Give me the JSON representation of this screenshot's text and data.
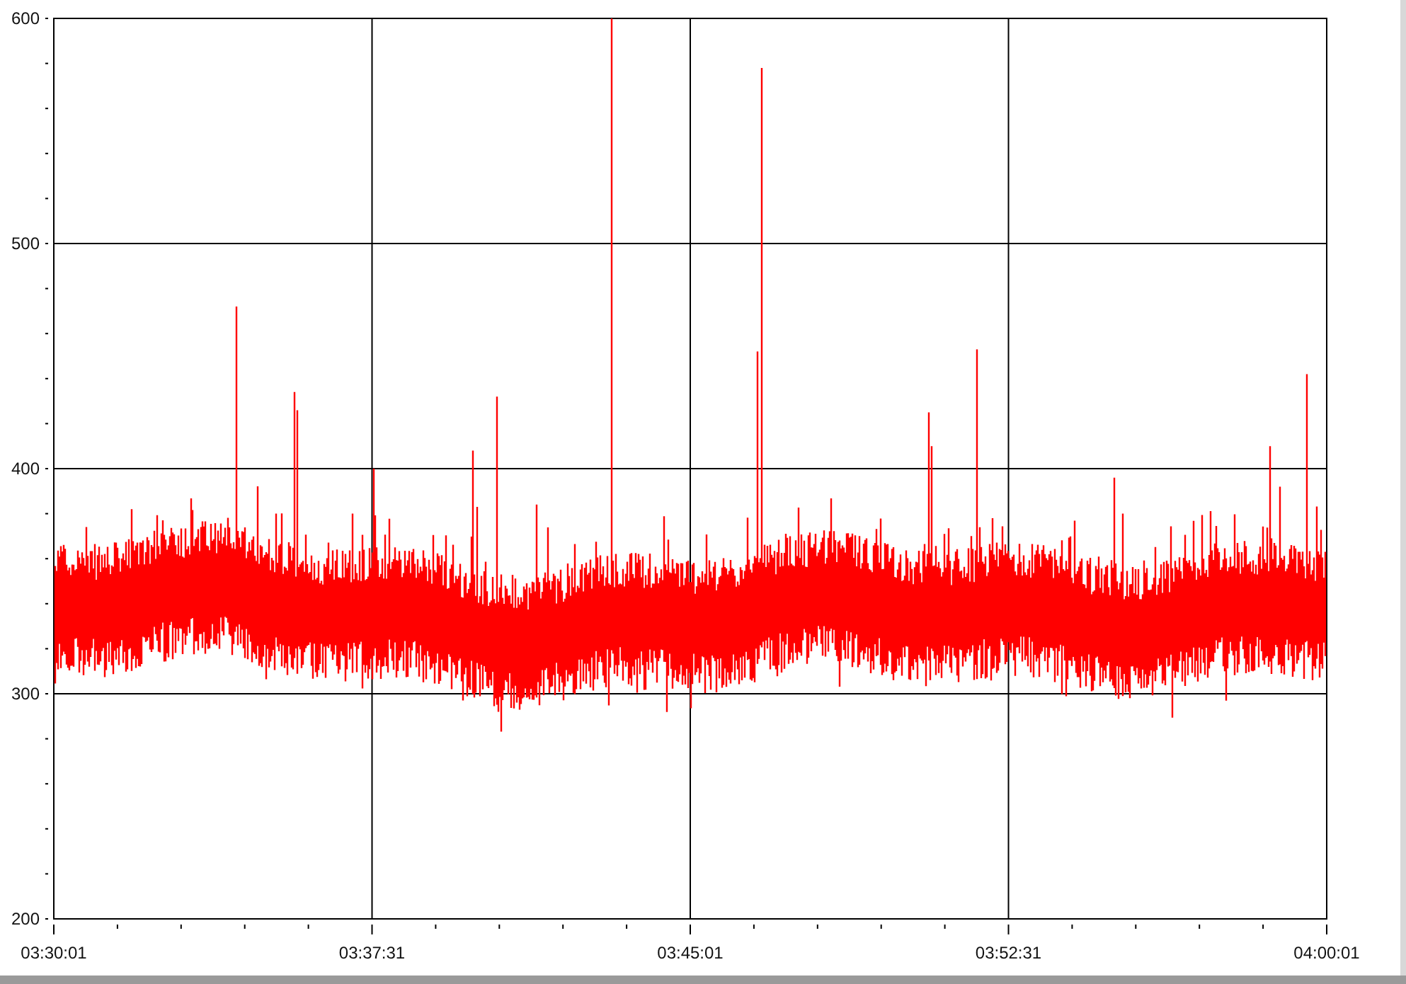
{
  "chart": {
    "y_ticks": [
      "600",
      "500",
      "400",
      "300",
      "200"
    ],
    "x_ticks": [
      "03:30:01",
      "03:37:31",
      "03:45:01",
      "03:52:31",
      "04:00:01"
    ]
  }
}
